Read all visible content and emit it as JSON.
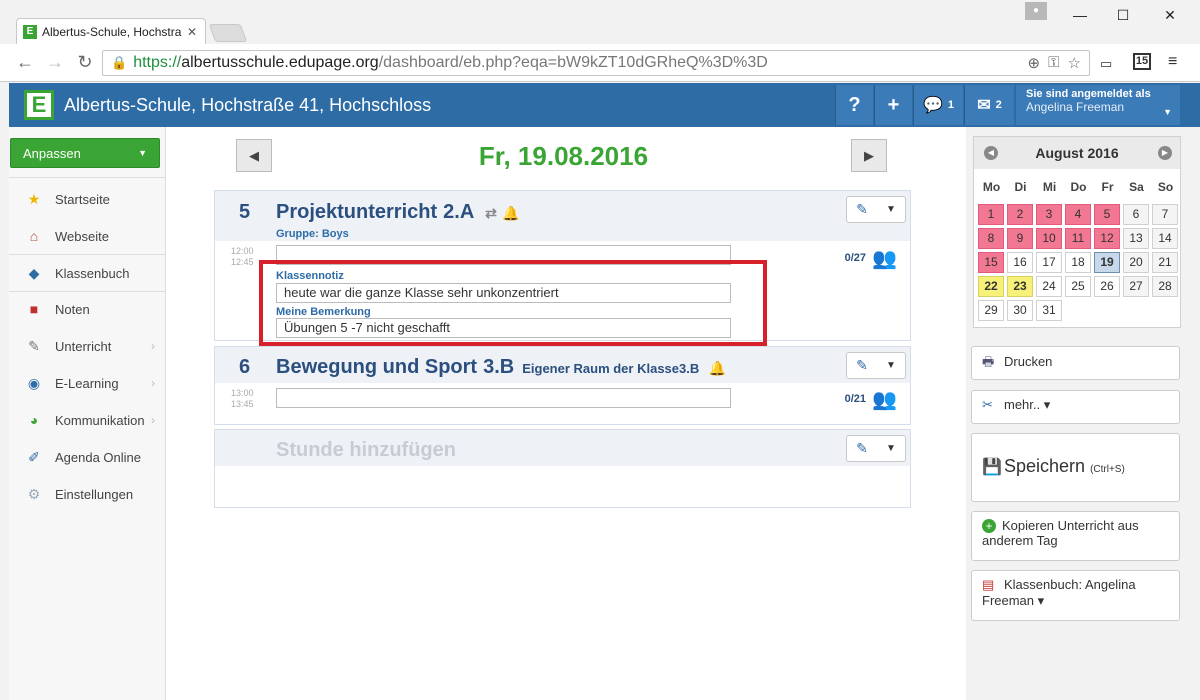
{
  "browser": {
    "tab_title": "Albertus-Schule, Hochstra",
    "tab_close": "✕",
    "window_controls": [
      "—",
      "☐",
      "✕"
    ],
    "url_https": "https://",
    "url_host": "albertusschule.edupage.org",
    "url_path": "/dashboard/eb.php?eqa=bW9kZT10dGRheQ%3D%3D",
    "calendar_ext": "15"
  },
  "header": {
    "logo": "E",
    "school_name": "Albertus-Schule, Hochstraße 41, Hochschloss",
    "help": "?",
    "add": "+",
    "messages_count": "1",
    "mail_count": "2",
    "login_label": "Sie sind angemeldet als",
    "user_name": "Angelina Freeman"
  },
  "sidebar": {
    "customize": "Anpassen",
    "items": [
      {
        "label": "Startseite"
      },
      {
        "label": "Webseite"
      },
      {
        "label": "Klassenbuch"
      },
      {
        "label": "Noten"
      },
      {
        "label": "Unterricht"
      },
      {
        "label": "E-Learning"
      },
      {
        "label": "Kommunikation"
      },
      {
        "label": "Agenda Online"
      },
      {
        "label": "Einstellungen"
      }
    ]
  },
  "main": {
    "date": "Fr, 19.08.2016",
    "prev": "◀",
    "next": "▶",
    "lessons": [
      {
        "number": "5",
        "subject": "Projektunterricht",
        "class": "2.A",
        "group_label": "Gruppe:",
        "group": "Boys",
        "time_start": "12:00",
        "time_end": "12:45",
        "topic": "",
        "count": "0/27",
        "class_note_label": "Klassennotiz",
        "class_note": "heute war die ganze Klasse sehr unkonzentriert",
        "my_note_label": "Meine Bemerkung",
        "my_note": "Übungen 5 -7 nicht geschafft"
      },
      {
        "number": "6",
        "subject": "Bewegung und Sport",
        "class": "3.B",
        "room": "Eigener Raum der Klasse3.B",
        "time_start": "13:00",
        "time_end": "13:45",
        "topic": "",
        "count": "0/21"
      }
    ],
    "add_lesson": "Stunde hinzufügen"
  },
  "calendar": {
    "month": "August 2016",
    "weekdays": [
      "Mo",
      "Di",
      "Mi",
      "Do",
      "Fr",
      "Sa",
      "So"
    ],
    "weeks": [
      [
        "1",
        "2",
        "3",
        "4",
        "5",
        "6",
        "7"
      ],
      [
        "8",
        "9",
        "10",
        "11",
        "12",
        "13",
        "14"
      ],
      [
        "15",
        "16",
        "17",
        "18",
        "19",
        "20",
        "21"
      ],
      [
        "22",
        "23",
        "24",
        "25",
        "26",
        "27",
        "28"
      ],
      [
        "29",
        "30",
        "31"
      ]
    ]
  },
  "right_panel": {
    "print": "Drucken",
    "more": "mehr.. ▾",
    "save": "Speichern",
    "save_shortcut": "(Ctrl+S)",
    "copy": "Kopieren Unterricht aus anderem Tag",
    "classbook": "Klassenbuch: Angelina Freeman ▾"
  },
  "colors": {
    "header_blue": "#2e6ca6",
    "accent_green": "#3aa535",
    "holiday_pink": "#f27792",
    "highlight_yellow": "#f7f17a",
    "annotation_red": "#d8202a"
  }
}
